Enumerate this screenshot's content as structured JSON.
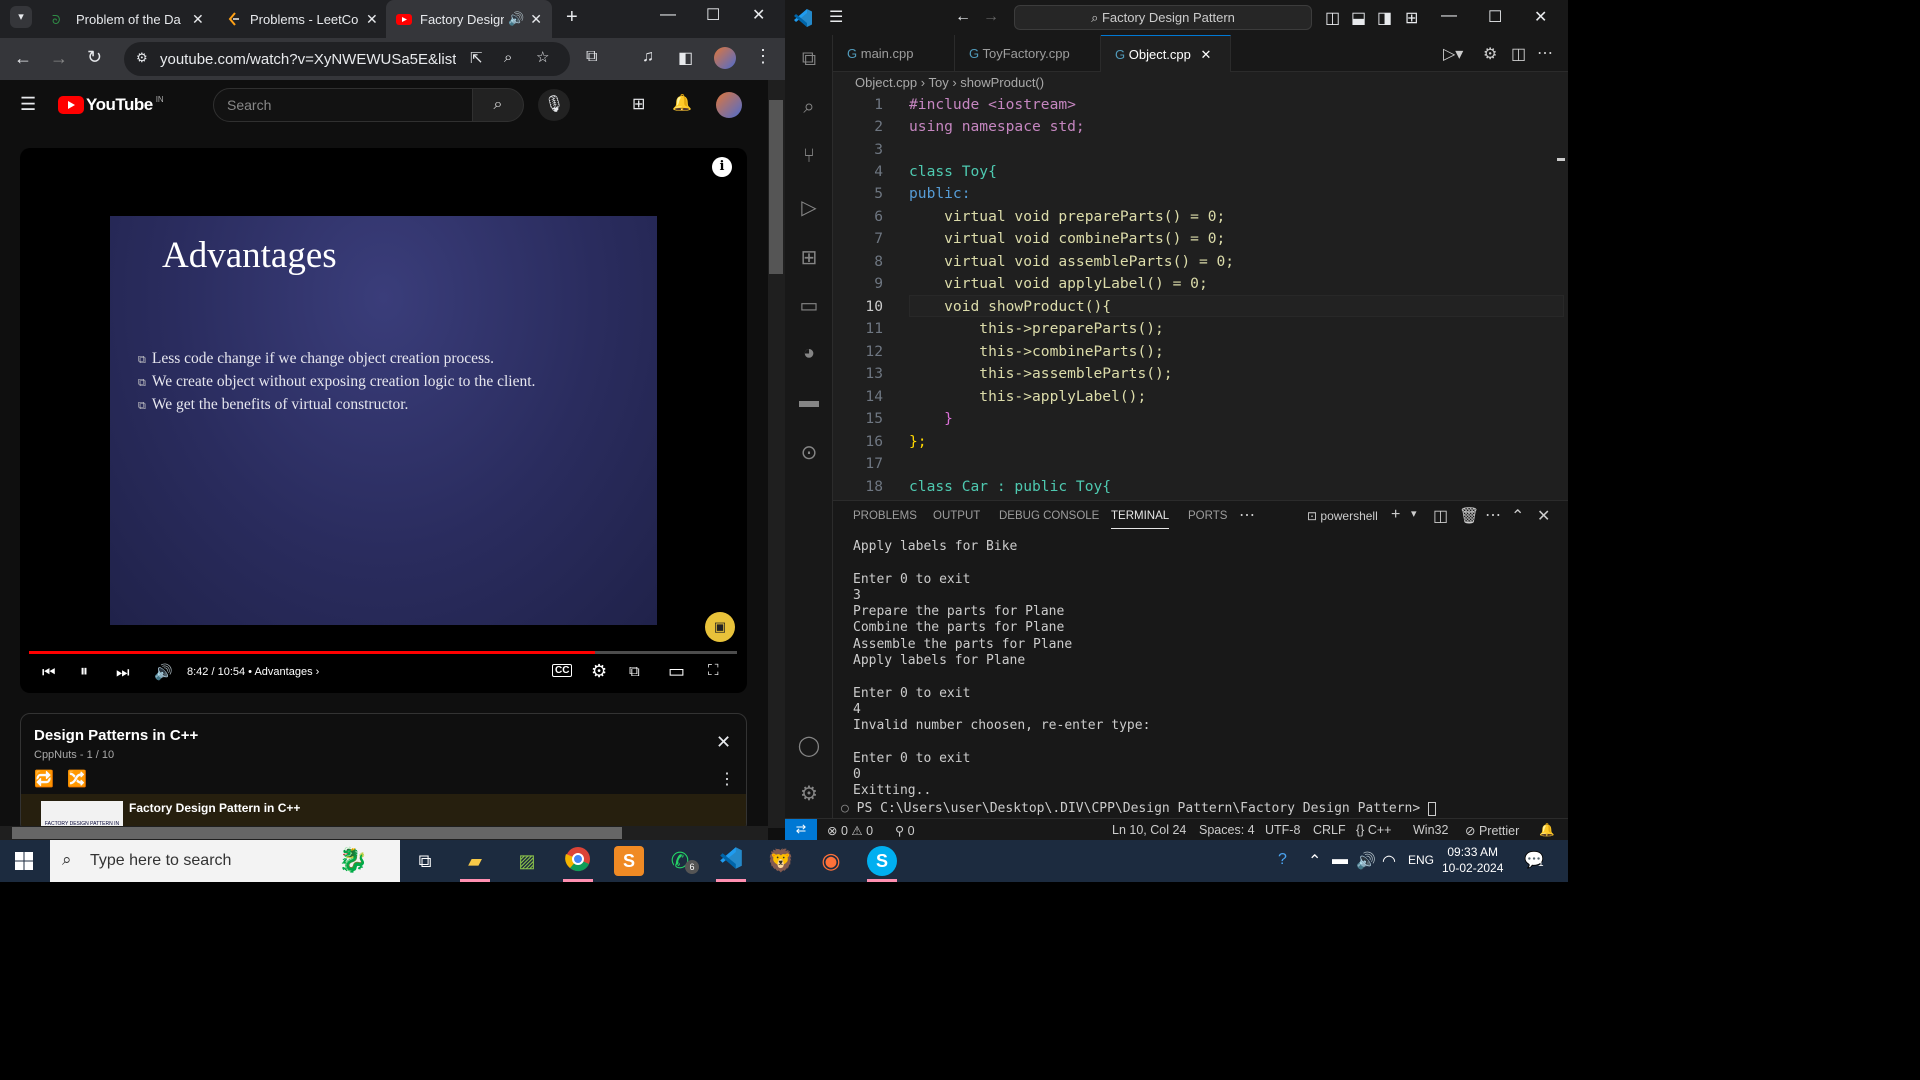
{
  "browser": {
    "tabs": [
      {
        "label": "Problem of the Da",
        "active": false
      },
      {
        "label": "Problems - LeetCo",
        "active": false
      },
      {
        "label": "Factory Design",
        "active": true
      }
    ],
    "url": "youtube.com/watch?v=XyNWEWUSa5E&list=..."
  },
  "youtube": {
    "logo": "YouTube",
    "region": "IN",
    "search_placeholder": "Search",
    "slide": {
      "title": "Advantages",
      "bullets": [
        "Less code change if we change object creation process.",
        "We create object without exposing creation logic to the client.",
        "We get the benefits of virtual constructor."
      ]
    },
    "time": "8:42 / 10:54",
    "chapter": "Advantages",
    "progress": 0.8,
    "playlist": {
      "title": "Design Patterns in C++",
      "subtitle": "CppNuts - 1 / 10",
      "item_title": "Factory Design Pattern in C++",
      "thumb_text": "FACTORY DESIGN PATTERN IN C++"
    }
  },
  "vscode": {
    "search": "Factory Design Pattern",
    "tabs": [
      "main.cpp",
      "ToyFactory.cpp",
      "Object.cpp"
    ],
    "breadcrumb": [
      "Object.cpp",
      "Toy",
      "showProduct()"
    ],
    "line_numbers": [
      "1",
      "2",
      "3",
      "4",
      "5",
      "6",
      "7",
      "8",
      "9",
      "10",
      "11",
      "12",
      "13",
      "14",
      "15",
      "16",
      "17",
      "18"
    ],
    "code_lines": [
      "#include <iostream>",
      "using namespace std;",
      "",
      "class Toy{",
      "public:",
      "    virtual void prepareParts() = 0;",
      "    virtual void combineParts() = 0;",
      "    virtual void assembleParts() = 0;",
      "    virtual void applyLabel() = 0;",
      "    void showProduct(){",
      "        this->prepareParts();",
      "        this->combineParts();",
      "        this->assembleParts();",
      "        this->applyLabel();",
      "    }",
      "};",
      "",
      "class Car : public Toy{"
    ],
    "panel_tabs": [
      "PROBLEMS",
      "OUTPUT",
      "DEBUG CONSOLE",
      "TERMINAL",
      "PORTS"
    ],
    "shell": "powershell",
    "terminal": "Apply labels for Bike\n\nEnter 0 to exit\n3\nPrepare the parts for Plane\nCombine the parts for Plane\nAssemble the parts for Plane\nApply labels for Plane\n\nEnter 0 to exit\n4\nInvalid number choosen, re-enter type:\n\nEnter 0 to exit\n0\nExitting..",
    "prompt": "PS C:\\Users\\user\\Desktop\\.DIV\\CPP\\Design Pattern\\Factory Design Pattern> ",
    "status": {
      "errors": "0",
      "warnings": "0",
      "ports": "0",
      "position": "Ln 10, Col 24",
      "spaces": "Spaces: 4",
      "encoding": "UTF-8",
      "eol": "CRLF",
      "language": "C++",
      "platform": "Win32",
      "formatter": "Prettier"
    }
  },
  "taskbar": {
    "search_placeholder": "Type here to search",
    "whatsapp_badge": "6",
    "lang": "ENG",
    "time": "09:33 AM",
    "date": "10-02-2024",
    "notif_count": "1"
  },
  "colors": {
    "yt_red": "#ff0000",
    "vs_blue": "#0078d4"
  }
}
